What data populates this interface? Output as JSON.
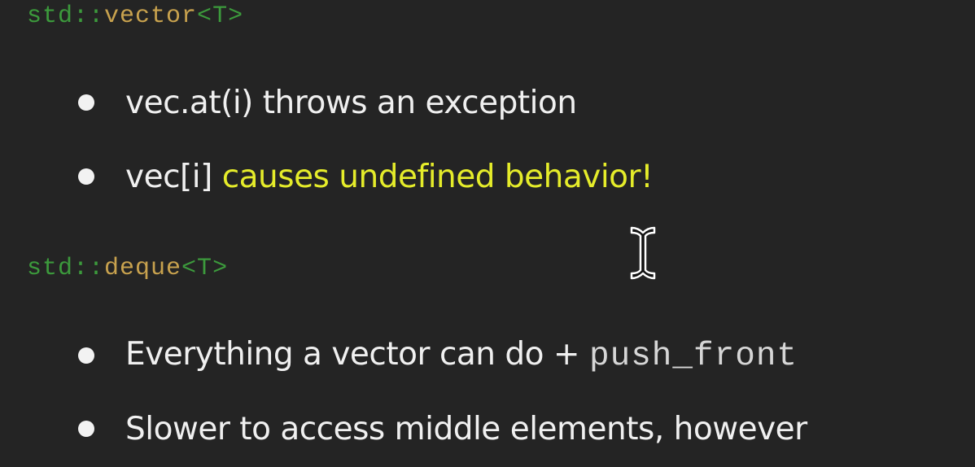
{
  "slide": {
    "section1": {
      "prefix": "std::",
      "name": "vector",
      "lt": "<",
      "param": "T",
      "gt": ">"
    },
    "section1_bullets": [
      {
        "text": "vec.at(i) throws an exception"
      },
      {
        "text": "vec[i] ",
        "highlight": "causes undefined behavior!"
      }
    ],
    "section2": {
      "prefix": "std::",
      "name": "deque",
      "lt": "<",
      "param": "T",
      "gt": ">"
    },
    "section2_bullets": [
      {
        "text": "Everything a vector can do + ",
        "code": "push_front"
      },
      {
        "text": "Slower to access middle elements, however"
      }
    ]
  },
  "colors": {
    "background": "#242424",
    "keyword_green": "#3c9a3c",
    "identifier_tan": "#c8a24e",
    "highlight_yellow": "#e5ec2a",
    "text": "#f0f0f0"
  },
  "icons": {
    "cursor": "text-cursor-icon",
    "bullet": "bullet-dot-icon"
  }
}
